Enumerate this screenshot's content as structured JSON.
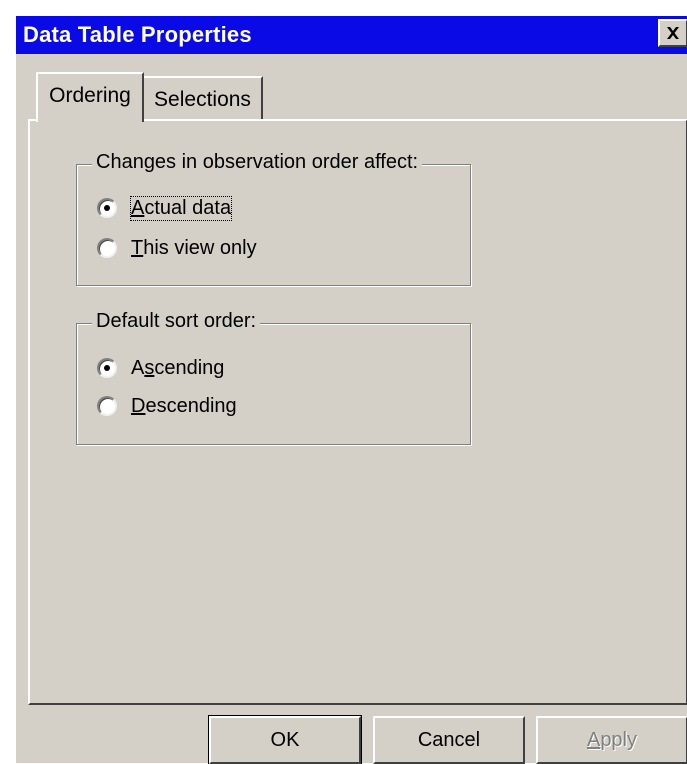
{
  "dialog": {
    "title": "Data Table Properties",
    "close_icon": "close-icon"
  },
  "tabs": [
    {
      "label": "Ordering",
      "selected": true
    },
    {
      "label": "Selections",
      "selected": false
    }
  ],
  "observation_order_group": {
    "legend": "Changes in observation order affect:",
    "options": [
      {
        "prefix": "",
        "mnemonic": "A",
        "rest": "ctual data",
        "checked": true
      },
      {
        "prefix": "",
        "mnemonic": "T",
        "rest": "his view only",
        "checked": false
      }
    ]
  },
  "sort_order_group": {
    "legend": "Default sort order:",
    "options": [
      {
        "prefix": "A",
        "mnemonic": "s",
        "rest": "cending",
        "checked": true
      },
      {
        "prefix": "",
        "mnemonic": "D",
        "rest": "escending",
        "checked": false
      }
    ]
  },
  "buttons": {
    "ok": "OK",
    "cancel": "Cancel",
    "apply": {
      "mnemonic": "A",
      "rest": "pply",
      "enabled": false
    }
  },
  "colors": {
    "titlebar": "#0a0ae6",
    "face": "#d4d0c8"
  }
}
